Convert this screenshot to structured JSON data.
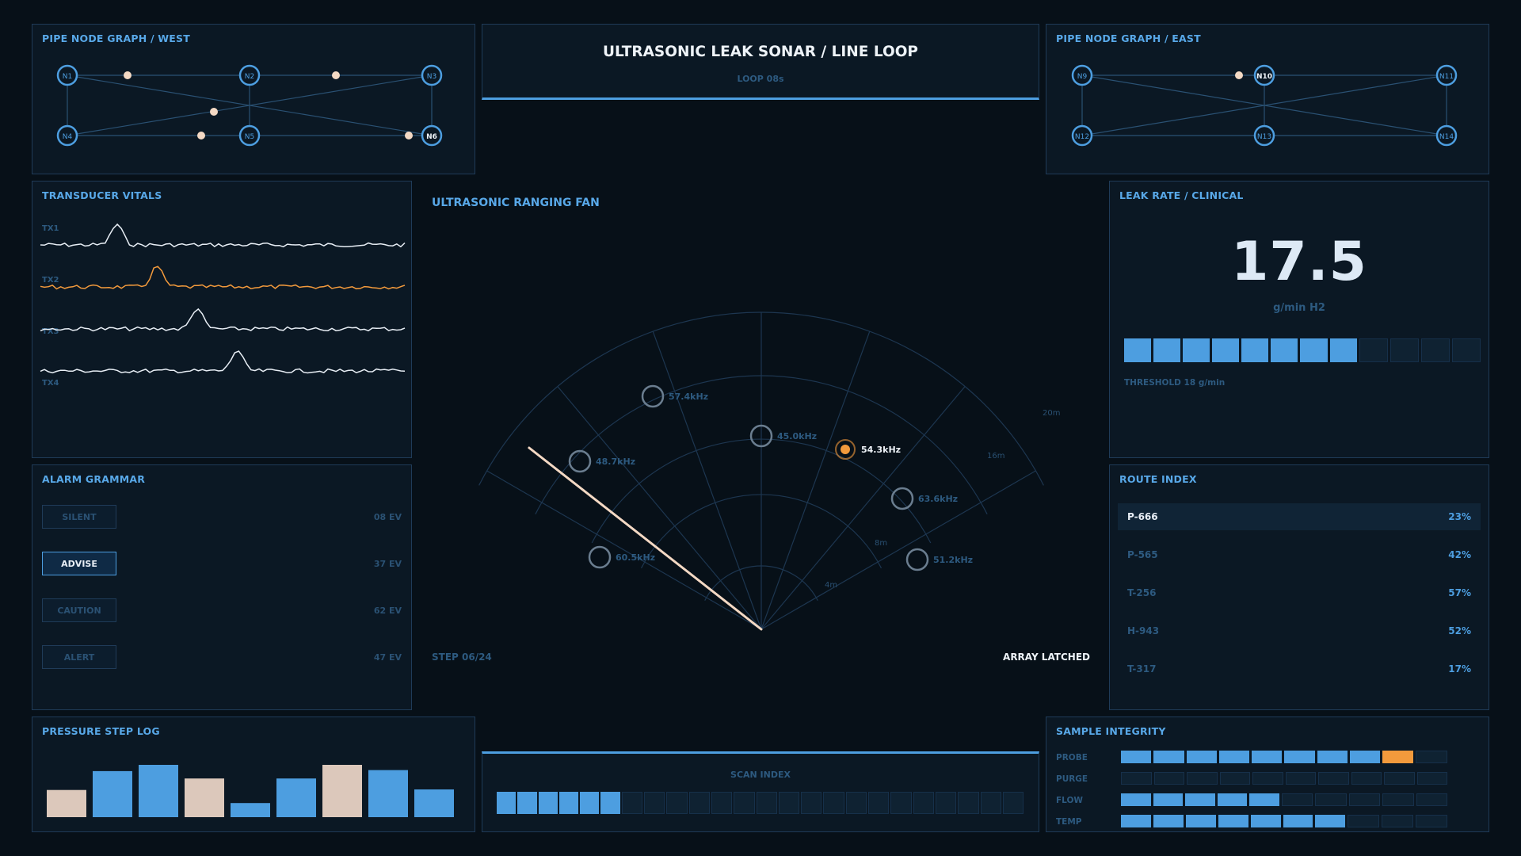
{
  "header": {
    "title": "ULTRASONIC LEAK SONAR / LINE LOOP",
    "subtitle": "LOOP 08s"
  },
  "pipe_west": {
    "title": "PIPE NODE GRAPH / WEST",
    "nodes": [
      "N1",
      "N2",
      "N3",
      "N4",
      "N5",
      "N6"
    ],
    "active_node": "N6"
  },
  "pipe_east": {
    "title": "PIPE NODE GRAPH / EAST",
    "nodes": [
      "N9",
      "N10",
      "N11",
      "N12",
      "N13",
      "N14"
    ],
    "active_node": "N10"
  },
  "vitals": {
    "title": "TRANSDUCER VITALS",
    "channels": [
      {
        "label": "TX1",
        "color": "#e8eef5",
        "peak_pos": 0.21
      },
      {
        "label": "TX2",
        "color": "#f39a3c",
        "peak_pos": 0.32
      },
      {
        "label": "TX3",
        "color": "#e8eef5",
        "peak_pos": 0.43
      },
      {
        "label": "TX4",
        "color": "#e8eef5",
        "peak_pos": 0.54
      }
    ]
  },
  "fan": {
    "title": "ULTRASONIC RANGING FAN",
    "step": "STEP 06/24",
    "status": "ARRAY LATCHED",
    "ring_labels": [
      "4m",
      "8m",
      "16m",
      "20m"
    ],
    "sweep_angle_deg": -52,
    "targets": [
      {
        "label": "57.4kHz",
        "active": false
      },
      {
        "label": "45.0kHz",
        "active": false
      },
      {
        "label": "54.3kHz",
        "active": true
      },
      {
        "label": "48.7kHz",
        "active": false
      },
      {
        "label": "63.6kHz",
        "active": false
      },
      {
        "label": "60.5kHz",
        "active": false
      },
      {
        "label": "51.2kHz",
        "active": false
      }
    ]
  },
  "leak": {
    "title": "LEAK RATE / CLINICAL",
    "value": "17.5",
    "unit": "g/min H2",
    "threshold": "THRESHOLD 18 g/min",
    "filled_segments": 8,
    "total_segments": 12
  },
  "alarm": {
    "title": "ALARM GRAMMAR",
    "items": [
      {
        "label": "SILENT",
        "value": "08 EV",
        "active": false
      },
      {
        "label": "ADVISE",
        "value": "37 EV",
        "active": true
      },
      {
        "label": "CAUTION",
        "value": "62 EV",
        "active": false
      },
      {
        "label": "ALERT",
        "value": "47 EV",
        "active": false
      }
    ]
  },
  "routes": {
    "title": "ROUTE INDEX",
    "items": [
      {
        "id": "P-666",
        "pct": "23%",
        "active": true
      },
      {
        "id": "P-565",
        "pct": "42%",
        "active": false
      },
      {
        "id": "T-256",
        "pct": "57%",
        "active": false
      },
      {
        "id": "H-943",
        "pct": "52%",
        "active": false
      },
      {
        "id": "T-317",
        "pct": "17%",
        "active": false
      }
    ]
  },
  "pressure": {
    "title": "PRESSURE STEP LOG",
    "values": [
      0.52,
      0.88,
      1.0,
      0.74,
      0.27,
      0.74,
      1.0,
      0.9,
      0.53
    ],
    "colors": [
      "#dcc8bb",
      "#4d9ee0",
      "#4d9ee0",
      "#dcc8bb",
      "#4d9ee0",
      "#4d9ee0",
      "#dcc8bb",
      "#4d9ee0",
      "#4d9ee0"
    ]
  },
  "scan": {
    "title": "SCAN INDEX",
    "filled": 6,
    "total": 24
  },
  "integrity": {
    "title": "SAMPLE INTEGRITY",
    "rows": [
      {
        "label": "PROBE",
        "filled": 9,
        "accent": true
      },
      {
        "label": "PURGE",
        "filled": 0,
        "accent": false
      },
      {
        "label": "FLOW",
        "filled": 5,
        "accent": false
      },
      {
        "label": "TEMP",
        "filled": 7,
        "accent": false
      }
    ],
    "total": 10
  },
  "colors": {
    "accent": "#4d9ee0",
    "orange": "#f39a3c",
    "cream": "#dcc8bb",
    "empty": "#0f2232"
  }
}
